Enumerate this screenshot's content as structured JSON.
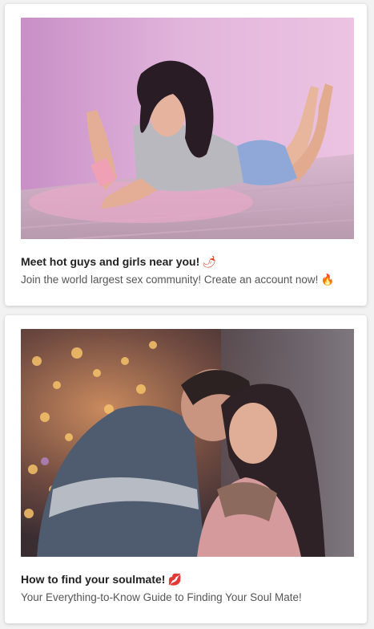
{
  "cards": [
    {
      "title": "Meet hot guys and girls near you!",
      "title_emoji": "🌶",
      "description": "Join the world largest sex community! Create an account now!",
      "description_emoji": "🔥"
    },
    {
      "title": "How to find your soulmate!",
      "title_emoji": "💋",
      "description": "Your Everything-to-Know Guide to Finding Your Soul Mate!"
    }
  ],
  "colors": {
    "title_text": "#222222",
    "description_text": "#555555",
    "card_background": "#ffffff",
    "page_background": "#f2f2f2",
    "chili_red": "#d83a1a",
    "fire_orange": "#f29a1e",
    "lips_red": "#c8102e"
  }
}
